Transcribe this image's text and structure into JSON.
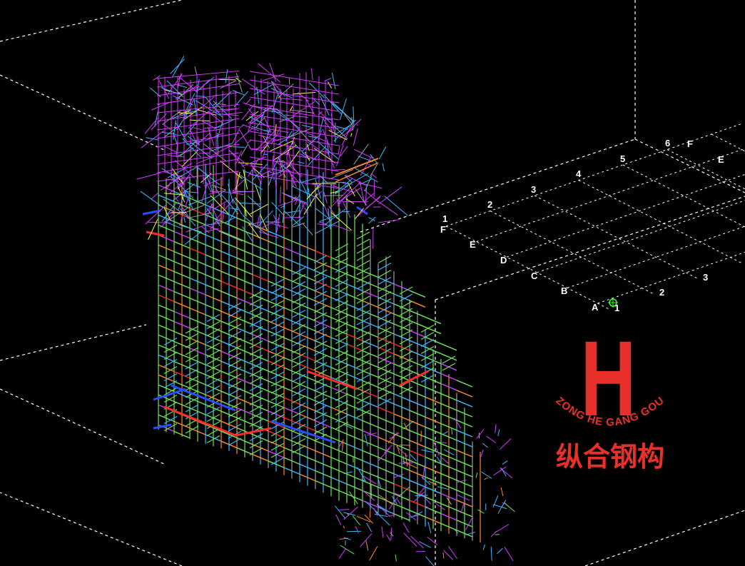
{
  "viewport": {
    "background": "#000000",
    "view_mode": "3D wireframe"
  },
  "grid_axes": {
    "near_numbers": [
      "1",
      "2",
      "3",
      "4",
      "5",
      "6"
    ],
    "near_letters": [
      "F",
      "E",
      "D",
      "C",
      "B",
      "A"
    ],
    "far_letters": [
      "F",
      "E"
    ],
    "right_numbers": [
      "1",
      "2",
      "3"
    ]
  },
  "logo": {
    "mark": "H",
    "arc_text": "ZONG HE GANG GOU",
    "company_name": "纵合钢构",
    "color": "#e8302a"
  },
  "member_colors": {
    "green": "#6fe35c",
    "magenta": "#d23cff",
    "cyan": "#3fb8ff",
    "orange": "#ff8a2a",
    "red": "#ff2a2a",
    "blue": "#2a4dff",
    "yellow": "#f5ff4a",
    "gray": "#9aa0a8"
  }
}
